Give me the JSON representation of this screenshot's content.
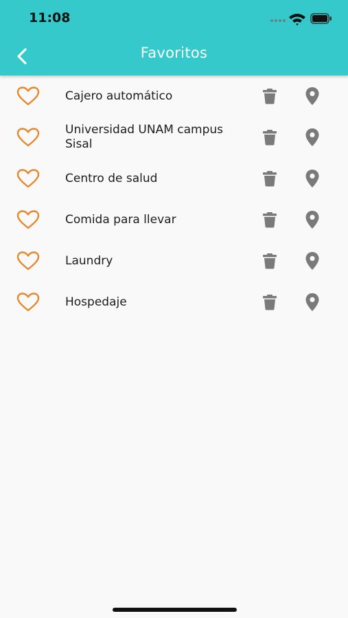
{
  "status_bar": {
    "time": "11:08"
  },
  "header": {
    "title": "Favoritos"
  },
  "favorites": [
    {
      "name": "Cajero automático"
    },
    {
      "name": "Universidad UNAM campus Sisal"
    },
    {
      "name": "Centro de salud"
    },
    {
      "name": "Comida para llevar"
    },
    {
      "name": "Laundry"
    },
    {
      "name": "Hospedaje"
    }
  ],
  "colors": {
    "header": "#35c9cb",
    "heart": "#e8862a",
    "action_icons": "#7a7a7a",
    "background": "#f9f9f9"
  },
  "icons": {
    "back": "chevron-left-icon",
    "favorite": "heart-outline-icon",
    "delete": "trash-icon",
    "location": "map-pin-icon"
  }
}
